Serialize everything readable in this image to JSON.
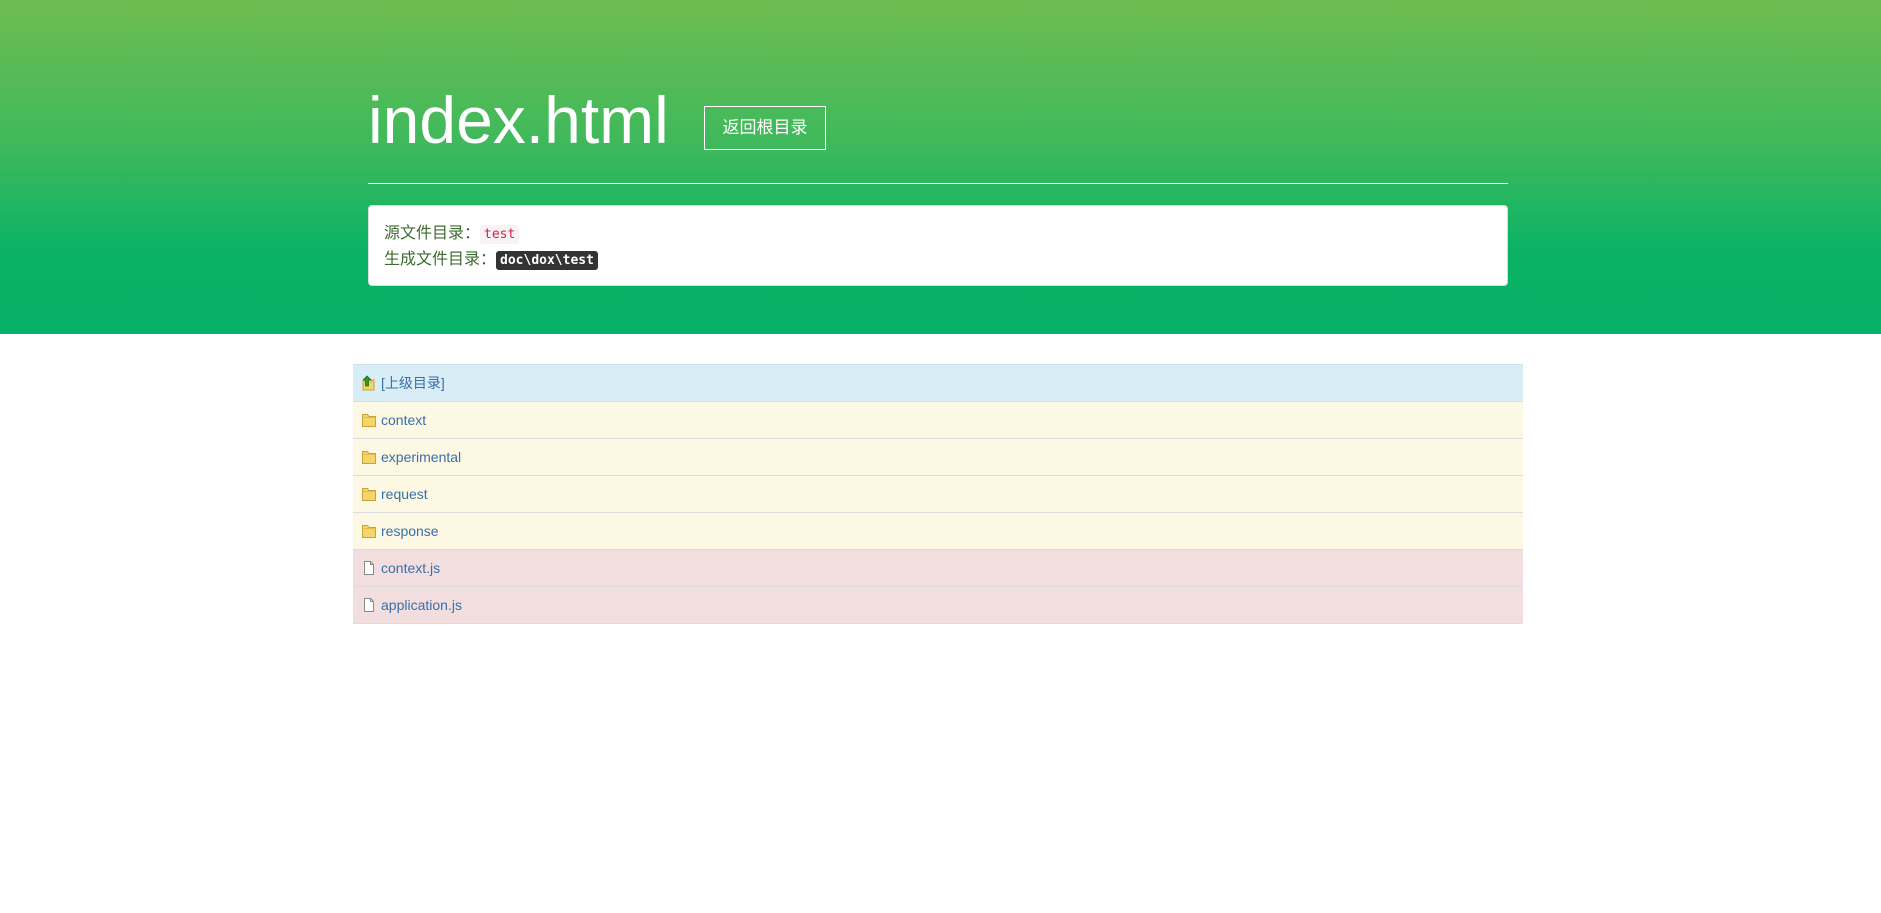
{
  "header": {
    "title": "index.html",
    "home_button_label": "返回根目录"
  },
  "info": {
    "source_label": "源文件目录：",
    "source_value": "test",
    "output_label": "生成文件目录：",
    "output_value": "doc\\dox\\test"
  },
  "entries": [
    {
      "name": "[上级目录]",
      "kind": "parent",
      "icon": "parent-folder-icon"
    },
    {
      "name": "context",
      "kind": "folder",
      "icon": "folder-icon"
    },
    {
      "name": "experimental",
      "kind": "folder",
      "icon": "folder-icon"
    },
    {
      "name": "request",
      "kind": "folder",
      "icon": "folder-icon"
    },
    {
      "name": "response",
      "kind": "folder",
      "icon": "folder-icon"
    },
    {
      "name": "context.js",
      "kind": "file",
      "icon": "file-icon"
    },
    {
      "name": "application.js",
      "kind": "file",
      "icon": "file-icon"
    }
  ],
  "colors": {
    "header_top": "#6fbc51",
    "header_bottom": "#06b067",
    "parent_row": "#d9edf7",
    "folder_row": "#fcf8e3",
    "file_row": "#f2dede",
    "link": "#3a6fa8"
  }
}
